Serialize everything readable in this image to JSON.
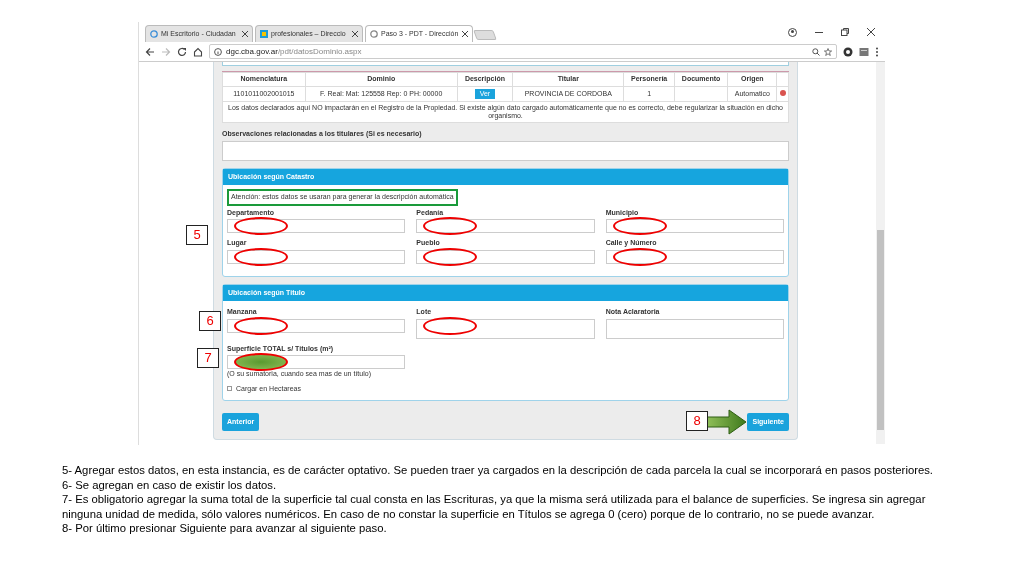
{
  "browser": {
    "tabs": [
      {
        "title": "Mi Escritorio - Ciudadan",
        "selected": false
      },
      {
        "title": "profesionales – Direccio",
        "selected": false
      },
      {
        "title": "Paso 3 - PDT - Dirección",
        "selected": true
      }
    ],
    "url_host": "dgc.cba.gov.ar",
    "url_path": "/pdt/datosDominio.aspx"
  },
  "table": {
    "columns": [
      "Nomenclatura",
      "Dominio",
      "Descripción",
      "Titular",
      "Personería",
      "Documento",
      "Origen"
    ],
    "rows": [
      {
        "cells": [
          "1101011002001015",
          "F. Real: Mat: 125558 Rep: 0 PH: 00000",
          "Ver",
          "PROVINCIA DE CORDOBA",
          "1",
          "",
          "Automatico"
        ]
      }
    ],
    "notice": "Los datos declarados aquí NO impactarán en el Registro de la Propiedad. Si existe algún dato cargado automáticamente que no es correcto, debe regularizar la situación en dicho organismo."
  },
  "observations": {
    "label": "Observaciones relacionadas a los titulares (Si es necesario)"
  },
  "catastro": {
    "title": "Ubicación según Catastro",
    "note": "Atención: estos datos se usaran para generar la descripción automática",
    "note_boxed": true,
    "fields": [
      {
        "label": "Departamento",
        "circled": true
      },
      {
        "label": "Pedanía",
        "circled": true
      },
      {
        "label": "Municipio",
        "circled": true
      },
      {
        "label": "Lugar",
        "circled": true
      },
      {
        "label": "Pueblo",
        "circled": true
      },
      {
        "label": "Calle y Número",
        "circled": true
      }
    ]
  },
  "titulo": {
    "title": "Ubicación según Título",
    "fields": [
      {
        "label": "Manzana",
        "kind": "input",
        "circled": true
      },
      {
        "label": "Lote",
        "kind": "textarea",
        "circled": true
      },
      {
        "label": "Nota Aclaratoria",
        "kind": "textarea",
        "circled": false
      }
    ],
    "surface": {
      "label": "Superficie TOTAL s/ Títulos (m²)",
      "circled": true,
      "shaded": true,
      "hint": "(O su sumatoria, cuando sea mas de un título)"
    },
    "checkbox": {
      "label": "Cargar en Hectareas",
      "checked": false
    }
  },
  "buttons": {
    "back": "Anterior",
    "next": "Siguiente"
  },
  "callouts": [
    "5",
    "6",
    "7",
    "8"
  ],
  "notes": [
    "5- Agregar estos datos, en esta instancia, es de carácter optativo. Se pueden traer ya cargados en la descripción de cada parcela  la cual se incorporará en pasos posteriores.",
    "6- Se agregan en caso de existir los datos.",
    "7- Es obligatorio agregar la suma total de la superficie tal cual consta en las Escrituras, ya que la misma será utilizada para el balance de superficies. Se ingresa sin agregar ninguna unidad de medida, sólo valores numéricos. En caso de no constar la superficie en Títulos se agrega 0 (cero) porque de lo contrario, no se puede avanzar.",
    "8- Por último presionar Siguiente para avanzar al siguiente paso."
  ]
}
